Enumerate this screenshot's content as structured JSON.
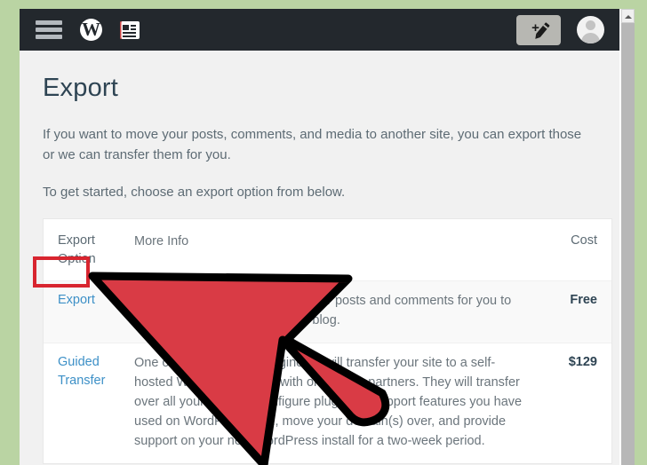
{
  "colors": {
    "page_background": "#bad4a3",
    "admin_bar": "#23282d",
    "content_background": "#f1f1f1",
    "link": "#3d90c7",
    "highlight_red": "#d8252f",
    "annotation_red": "#d93b45",
    "annotation_outline": "#000000"
  },
  "adminbar": {
    "menu_icon": "hamburger-menu-icon",
    "wordpress_logo": "W",
    "reader_icon": "reader-icon",
    "new_post_button": {
      "label": "+",
      "icon": "pencil-plus-icon"
    },
    "avatar": "user-avatar-icon"
  },
  "page": {
    "title": "Export",
    "intro_1": "If you want to move your posts, comments, and media to another site, you can export those or we can transfer them for you.",
    "intro_2": "To get started, choose an export option from below."
  },
  "table": {
    "headers": {
      "option": "Export Option",
      "option_line1": "Export",
      "option_line2": "Option",
      "info": "More Info",
      "cost": "Cost"
    },
    "rows": [
      {
        "option": "Export",
        "option_is_link": true,
        "info": "Create an XML file containing your posts and comments for you to import into another WordPress blog.",
        "info_prefix": "Create an XML file containing your posts and comments for you to ",
        "info_suffix": "s blog.",
        "cost": "Free"
      },
      {
        "option_line1": "Guided",
        "option_line2": "Transfer",
        "option": "Guided Transfer",
        "option_is_link": true,
        "info": "One of our Happiness Engineers will transfer your site to a self-hosted WordPress install with one of our partners. They will transfer over all your content, configure plugins to support features you have used on WordPress.com, move your domain(s) over, and provide support on your new WordPress install for a two-week period.",
        "info_line1_visible": "s will transfer your site to a self-hosted",
        "info_line2_visible": "one of our partners. They will transfer",
        "info_line3_visible": "figure plugins to support features",
        "info_line4_visible": "ur domain(s) over, and",
        "info_line5_visible": "install for a two-week",
        "info_line6_visible": "period.",
        "links": [
          "self-hosted",
          "our partners"
        ],
        "cost": "$129"
      }
    ]
  },
  "scrollbar": {
    "up_arrow": "scroll-up-arrow-icon",
    "position": "top"
  },
  "annotation": {
    "type": "cursor-arrow",
    "color": "#d93b45",
    "outline": "#000000",
    "points_to": "Export link"
  }
}
